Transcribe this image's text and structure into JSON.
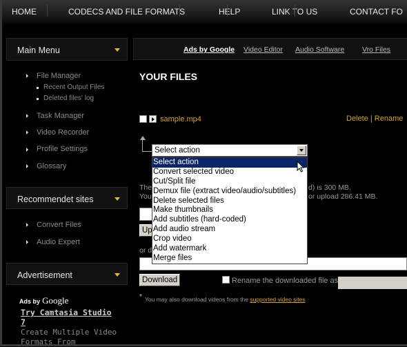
{
  "topnav": [
    "HOME",
    "CODECS AND FILE FORMATS",
    "HELP",
    "LINK TO US",
    "CONTACT FO"
  ],
  "sidebar": {
    "main_menu": {
      "title": "Main Menu",
      "items": [
        "File Manager",
        "Task Manager",
        "Video Recorder",
        "Profile Settings",
        "Glossary"
      ],
      "subitems": [
        "Recent Output Files",
        "Deleted files' log"
      ]
    },
    "recommended": {
      "title": "Recommendet sites",
      "items": [
        "Convert Files",
        "Audio Expert"
      ]
    },
    "advertisement": {
      "title": "Advertisement",
      "ads_by": "Ads by",
      "google": "Google",
      "ad_title": "Try Camtasia Studio 7",
      "ad_text": "Create Multiple Video Formats From"
    }
  },
  "adbar": {
    "ads_by_google": "Ads by Google",
    "links": [
      "Video Editor",
      "Audio Software",
      "Vro Files"
    ]
  },
  "main": {
    "heading": "YOUR FILES",
    "file": {
      "name": "sample.mp4",
      "delete": "Delete",
      "sep": "|",
      "rename": "Rename"
    },
    "select": {
      "value": "Select action",
      "options": [
        "Select action",
        "Convert selected video",
        "Cut/Split file",
        "Demux file (extract video/audio/subtitles)",
        "Delete selected files",
        "Make thumbnails",
        "Add subtitles (hard-coded)",
        "Add audio stream",
        "Crop video",
        "Add watermark",
        "Merge files"
      ]
    },
    "info1_a": "The",
    "info1_b": "d) is 300 MB.",
    "info2_a": "You",
    "info2_b": "or upload 286.41 MB.",
    "upload_partial": "Up",
    "or_partial": "or d",
    "download": "Download",
    "rename_label": "Rename the downloaded file as",
    "note_star": "*",
    "note": "You may also download videos from the",
    "note_link": "supported video sites"
  },
  "colors": {
    "accent": "#e2b53b",
    "link": "#d4a040",
    "highlight": "#0a246a"
  }
}
